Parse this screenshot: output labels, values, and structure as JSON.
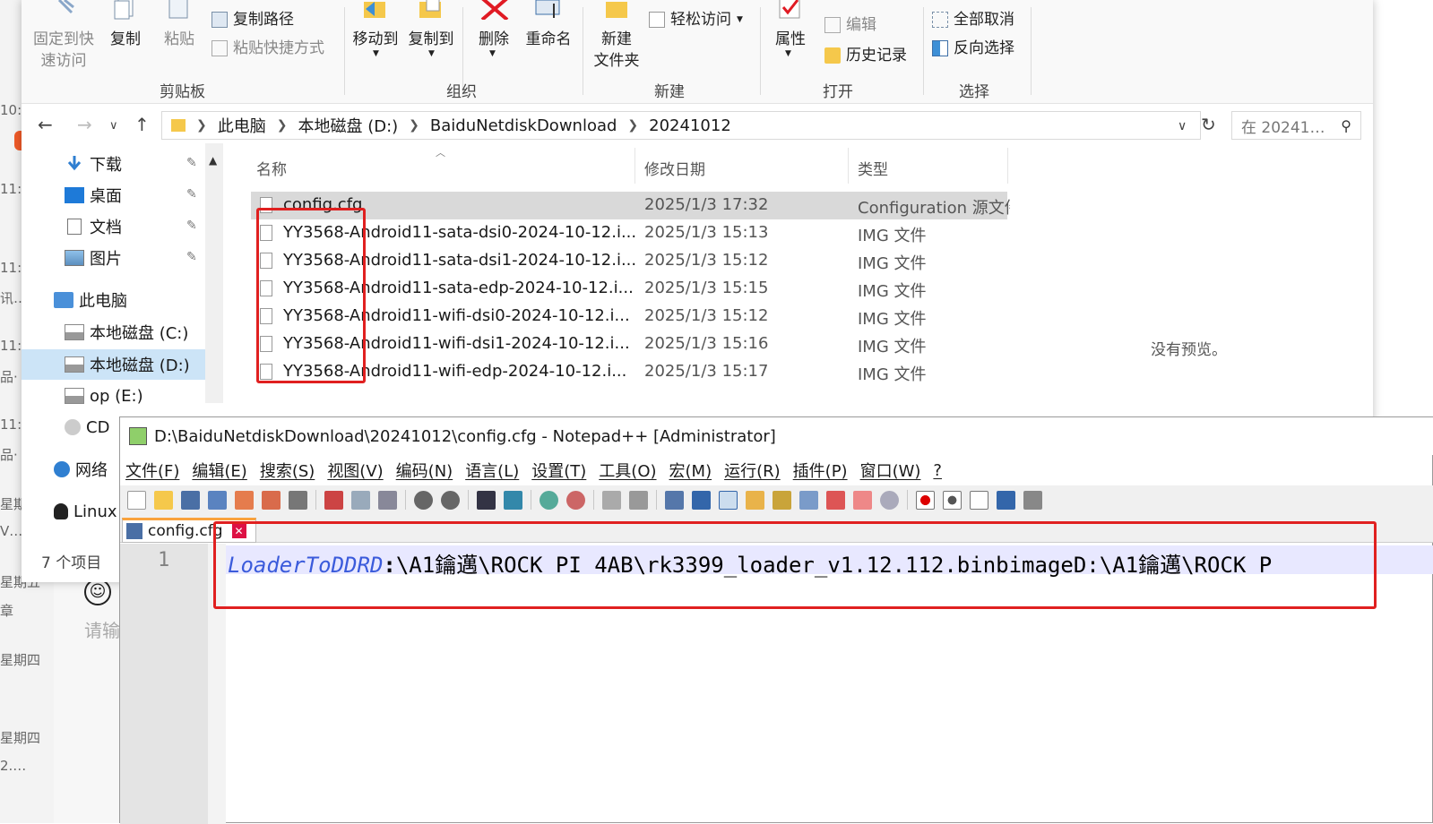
{
  "bg_left": {
    "items": [
      "10:",
      "11:",
      "11:",
      "讯…",
      "11:",
      "品·",
      "11:",
      "品·",
      "星期",
      "V…",
      "星期五",
      "章",
      "星期四",
      "星期四",
      "2.…"
    ]
  },
  "chat": {
    "input_hint": "请输"
  },
  "ribbon": {
    "pin_label": "固定到快\n速访问",
    "copy": "复制",
    "paste": "粘贴",
    "copy_path": "复制路径",
    "paste_shortcut": "粘贴快捷方式",
    "move_to": "移动到",
    "copy_to": "复制到",
    "delete": "删除",
    "rename": "重命名",
    "new_folder": "新建\n文件夹",
    "easy_access": "轻松访问",
    "properties": "属性",
    "edit": "编辑",
    "history": "历史记录",
    "select_none": "全部取消",
    "invert_select": "反向选择",
    "groups": {
      "clipboard": "剪贴板",
      "organize": "组织",
      "new": "新建",
      "open": "打开",
      "select": "选择"
    }
  },
  "address": {
    "crumbs": [
      "此电脑",
      "本地磁盘 (D:)",
      "BaiduNetdiskDownload",
      "20241012"
    ],
    "search_placeholder": "在 20241…"
  },
  "nav": {
    "items": [
      "下载",
      "桌面",
      "文档",
      "图片",
      "此电脑",
      "本地磁盘 (C:)",
      "本地磁盘 (D:)",
      "op (E:)",
      "CD",
      "网络",
      "Linux"
    ],
    "count": "7 个项目"
  },
  "columns": {
    "name": "名称",
    "date": "修改日期",
    "type": "类型"
  },
  "files": [
    {
      "name": "config.cfg",
      "date": "2025/1/3 17:32",
      "type": "Configuration 源文件"
    },
    {
      "name": "YY3568-Android11-sata-dsi0-2024-10-12.i...",
      "date": "2025/1/3 15:13",
      "type": "IMG 文件"
    },
    {
      "name": "YY3568-Android11-sata-dsi1-2024-10-12.i...",
      "date": "2025/1/3 15:12",
      "type": "IMG 文件"
    },
    {
      "name": "YY3568-Android11-sata-edp-2024-10-12.i...",
      "date": "2025/1/3 15:15",
      "type": "IMG 文件"
    },
    {
      "name": "YY3568-Android11-wifi-dsi0-2024-10-12.i...",
      "date": "2025/1/3 15:12",
      "type": "IMG 文件"
    },
    {
      "name": "YY3568-Android11-wifi-dsi1-2024-10-12.i...",
      "date": "2025/1/3 15:16",
      "type": "IMG 文件"
    },
    {
      "name": "YY3568-Android11-wifi-edp-2024-10-12.i...",
      "date": "2025/1/3 15:17",
      "type": "IMG 文件"
    }
  ],
  "preview": "没有预览。",
  "notepad": {
    "title": "D:\\BaiduNetdiskDownload\\20241012\\config.cfg - Notepad++ [Administrator]",
    "menu": [
      "文件(F)",
      "编辑(E)",
      "搜索(S)",
      "视图(V)",
      "编码(N)",
      "语言(L)",
      "设置(T)",
      "工具(O)",
      "宏(M)",
      "运行(R)",
      "插件(P)",
      "窗口(W)",
      "?"
    ],
    "tab": "config.cfg",
    "line_no": "1",
    "code_key": "LoaderToDDRD",
    "code_sep": ":",
    "code_rest": "\\A1鑰邁\\ROCK PI 4AB\\rk3399_loader_v1.12.112.binbimageD:\\A1鑰邁\\ROCK P"
  },
  "colors": {
    "accent": "#0078d4",
    "highlight": "#e02020",
    "selection": "#cce4f7"
  }
}
